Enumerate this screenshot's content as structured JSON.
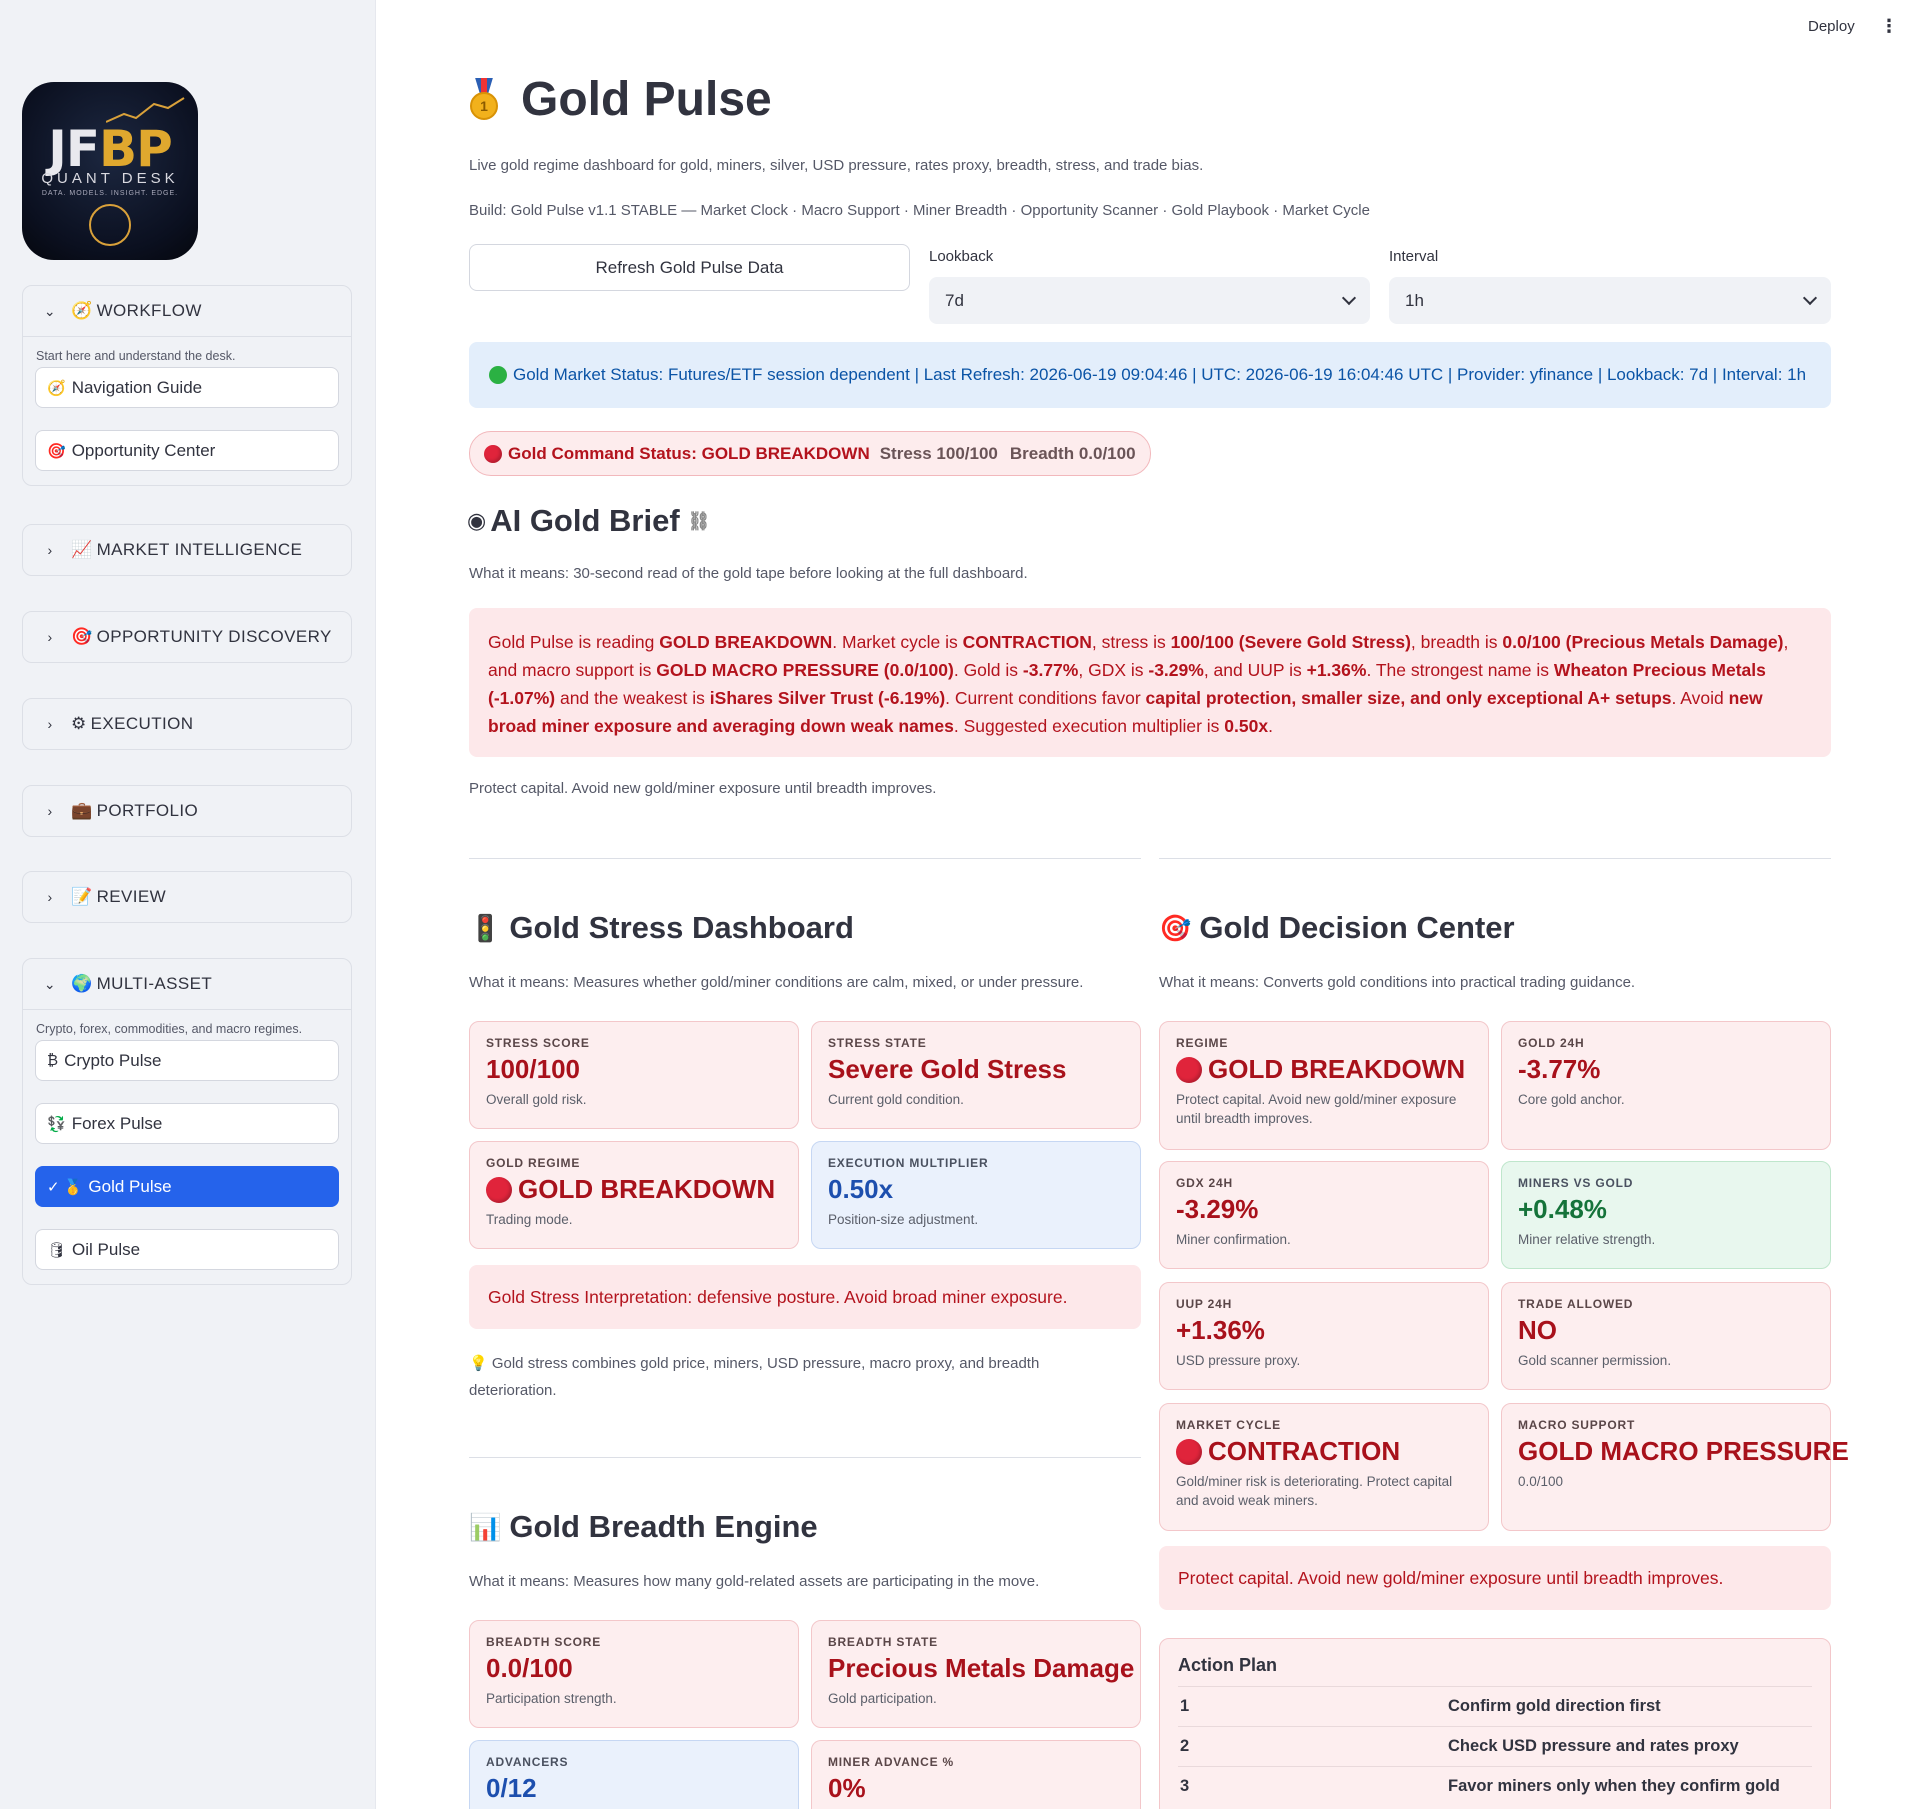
{
  "topbar": {
    "deploy_label": "Deploy"
  },
  "logo": {
    "text_main": "JF",
    "text_accent": "BP",
    "subtitle": "QUANT DESK",
    "tagline": "DATA. MODELS. INSIGHT. EDGE."
  },
  "sidebar": {
    "workflow": {
      "label": "WORKFLOW",
      "icon": "🧭",
      "caption": "Start here and understand the desk.",
      "items": [
        {
          "icon": "🧭",
          "label": "Navigation Guide"
        },
        {
          "icon": "🎯",
          "label": "Opportunity Center"
        }
      ]
    },
    "market_intelligence": {
      "label": "MARKET INTELLIGENCE",
      "icon": "📈"
    },
    "opportunity_discovery": {
      "label": "OPPORTUNITY DISCOVERY",
      "icon": "🎯"
    },
    "execution": {
      "label": "EXECUTION",
      "icon": "⚙"
    },
    "portfolio": {
      "label": "PORTFOLIO",
      "icon": "💼"
    },
    "review": {
      "label": "REVIEW",
      "icon": "📝"
    },
    "multi_asset": {
      "label": "MULTI-ASSET",
      "icon": "🌍",
      "caption": "Crypto, forex, commodities, and macro regimes.",
      "items": [
        {
          "icon": "₿",
          "label": "Crypto Pulse"
        },
        {
          "icon": "💱",
          "label": "Forex Pulse"
        },
        {
          "icon": "✓ 🥇",
          "label": "Gold Pulse"
        },
        {
          "icon": "🛢",
          "label": "Oil Pulse"
        }
      ]
    }
  },
  "header": {
    "title": "Gold Pulse",
    "subtitle": "Live gold regime dashboard for gold, miners, silver, USD pressure, rates proxy, breadth, stress, and trade bias.",
    "build": "Build: Gold Pulse v1.1 STABLE — Market Clock · Macro Support · Miner Breadth · Opportunity Scanner · Gold Playbook · Market Cycle"
  },
  "controls": {
    "refresh_label": "Refresh Gold Pulse Data",
    "lookback_label": "Lookback",
    "lookback_value": "7d",
    "interval_label": "Interval",
    "interval_value": "1h"
  },
  "status_bar": "Gold Market Status: Futures/ETF session dependent | Last Refresh: 2026-06-19 09:04:46 | UTC: 2026-06-19 16:04:46 UTC | Provider: yfinance | Lookback: 7d | Interval: 1h",
  "command": {
    "label": "Gold Command Status: GOLD BREAKDOWN",
    "stress": "Stress 100/100",
    "breadth": "Breadth 0.0/100"
  },
  "brief": {
    "title": "AI Gold Brief",
    "caption": "What it means: 30-second read of the gold tape before looking at the full dashboard.",
    "p1": "Gold Pulse is reading ",
    "b1": "GOLD BREAKDOWN",
    "p2": ". Market cycle is ",
    "b2": "CONTRACTION",
    "p3": ", stress is ",
    "b3": "100/100 (Severe Gold Stress)",
    "p4": ", breadth is ",
    "b4": "0.0/100 (Precious Metals Damage)",
    "p5": ", and macro support is ",
    "b5": "GOLD MACRO PRESSURE (0.0/100)",
    "p6": ". Gold is ",
    "b6": "-3.77%",
    "p7": ", GDX is ",
    "b7": "-3.29%",
    "p8": ", and UUP is ",
    "b8": "+1.36%",
    "p9": ". The strongest name is ",
    "b9": "Wheaton Precious Metals (-1.07%)",
    "p10": " and the weakest is ",
    "b10": "iShares Silver Trust (-6.19%)",
    "p11": ". Current conditions favor ",
    "b11": "capital protection, smaller size, and only exceptional A+ setups",
    "p12": ". Avoid ",
    "b12": "new broad miner exposure and averaging down weak names",
    "p13": ". Suggested execution multiplier is ",
    "b13": "0.50x",
    "p14": ".",
    "footer": "Protect capital. Avoid new gold/miner exposure until breadth improves."
  },
  "stress_dashboard": {
    "title": "Gold Stress Dashboard",
    "caption": "What it means: Measures whether gold/miner conditions are calm, mixed, or under pressure.",
    "cards": [
      {
        "label": "STRESS SCORE",
        "value": "100/100",
        "desc": "Overall gold risk."
      },
      {
        "label": "STRESS STATE",
        "value": "Severe Gold Stress",
        "desc": "Current gold condition."
      },
      {
        "label": "GOLD REGIME",
        "value": "GOLD BREAKDOWN",
        "desc": "Trading mode."
      },
      {
        "label": "EXECUTION MULTIPLIER",
        "value": "0.50x",
        "desc": "Position-size adjustment."
      }
    ],
    "interpretation": "Gold Stress Interpretation: defensive posture. Avoid broad miner exposure.",
    "note": "💡 Gold stress combines gold price, miners, USD pressure, macro proxy, and breadth deterioration."
  },
  "breadth_engine": {
    "title": "Gold Breadth Engine",
    "caption": "What it means: Measures how many gold-related assets are participating in the move.",
    "cards": [
      {
        "label": "BREADTH SCORE",
        "value": "0.0/100",
        "desc": "Participation strength."
      },
      {
        "label": "BREADTH STATE",
        "value": "Precious Metals Damage",
        "desc": "Gold participation."
      },
      {
        "label": "ADVANCERS",
        "value": "0/12",
        "desc": ""
      },
      {
        "label": "MINER ADVANCE %",
        "value": "0%",
        "desc": ""
      }
    ]
  },
  "decision_center": {
    "title": "Gold Decision Center",
    "caption": "What it means: Converts gold conditions into practical trading guidance.",
    "cards": [
      {
        "label": "REGIME",
        "value": "GOLD BREAKDOWN",
        "desc": "Protect capital. Avoid new gold/miner exposure until breadth improves."
      },
      {
        "label": "GOLD 24H",
        "value": "-3.77%",
        "desc": "Core gold anchor."
      },
      {
        "label": "GDX 24H",
        "value": "-3.29%",
        "desc": "Miner confirmation."
      },
      {
        "label": "MINERS VS GOLD",
        "value": "+0.48%",
        "desc": "Miner relative strength."
      },
      {
        "label": "UUP 24H",
        "value": "+1.36%",
        "desc": "USD pressure proxy."
      },
      {
        "label": "TRADE ALLOWED",
        "value": "NO",
        "desc": "Gold scanner permission."
      },
      {
        "label": "MARKET CYCLE",
        "value": "CONTRACTION",
        "desc": "Gold/miner risk is deteriorating. Protect capital and avoid weak miners."
      },
      {
        "label": "MACRO SUPPORT",
        "value": "GOLD MACRO PRESSURE",
        "desc": "0.0/100"
      }
    ],
    "banner": "Protect capital. Avoid new gold/miner exposure until breadth improves."
  },
  "action_plan": {
    "title": "Action Plan",
    "rows": [
      {
        "n": "1",
        "text": "Confirm gold direction first"
      },
      {
        "n": "2",
        "text": "Check USD pressure and rates proxy"
      },
      {
        "n": "3",
        "text": "Favor miners only when they confirm gold"
      }
    ]
  },
  "colors": {
    "accent": "#2563eb",
    "danger": "#b3131d",
    "danger_bg": "#fde8ea",
    "info_bg": "#e3eefb",
    "info_text": "#0b54a6",
    "success": "#15733a"
  }
}
